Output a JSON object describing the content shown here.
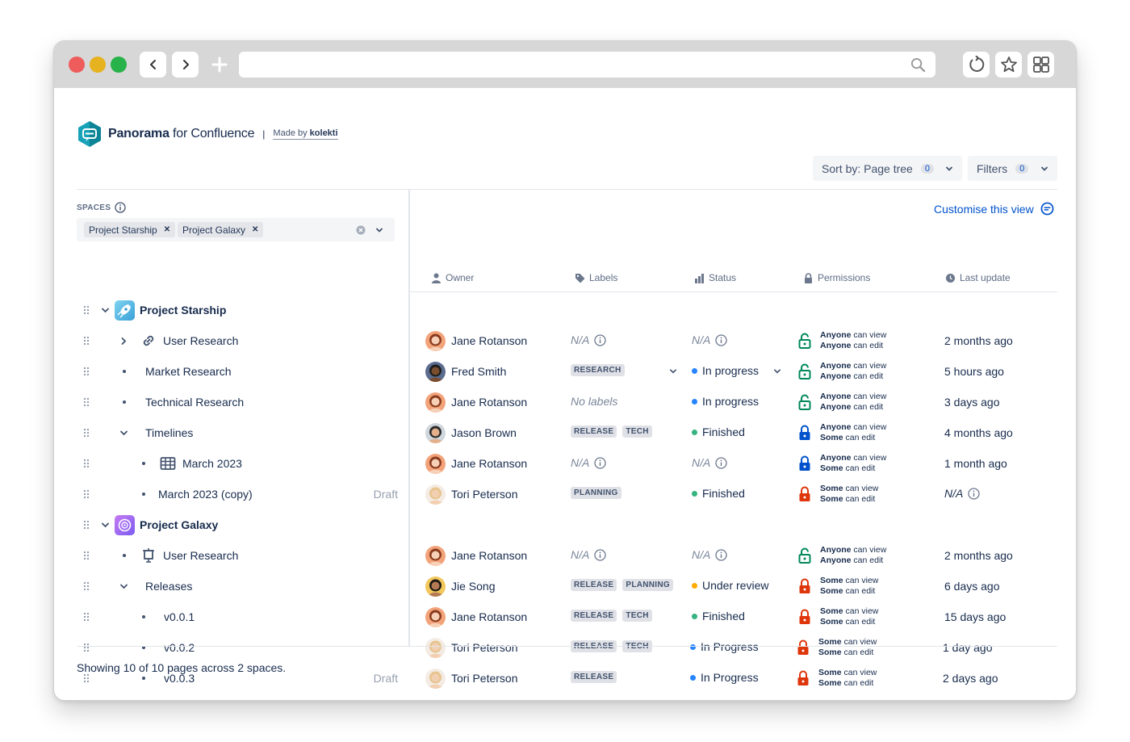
{
  "app": {
    "brand_bold": "Panorama",
    "brand_rest": " for Confluence",
    "separator": "|",
    "made_by_prefix": "Made by ",
    "made_by_company": "kolekti"
  },
  "toolbar": {
    "sort_label": "Sort by: Page tree",
    "sort_count": "0",
    "filters_label": "Filters",
    "filters_count": "0"
  },
  "spaces": {
    "heading": "SPACES",
    "selected": [
      "Project Starship",
      "Project Galaxy"
    ]
  },
  "customise_label": "Customise this view",
  "columns": {
    "owner": "Owner",
    "labels": "Labels",
    "status": "Status",
    "permissions": "Permissions",
    "last_update": "Last update"
  },
  "tree": [
    {
      "label": "Project Starship",
      "draft": ""
    },
    {
      "label": "User Research",
      "draft": ""
    },
    {
      "label": "Market Research",
      "draft": ""
    },
    {
      "label": "Technical Research",
      "draft": ""
    },
    {
      "label": "Timelines",
      "draft": ""
    },
    {
      "label": "March 2023",
      "draft": ""
    },
    {
      "label": "March 2023 (copy)",
      "draft": "Draft"
    },
    {
      "label": "Project Galaxy",
      "draft": ""
    },
    {
      "label": "User Research",
      "draft": ""
    },
    {
      "label": "Releases",
      "draft": ""
    },
    {
      "label": "v0.0.1",
      "draft": ""
    },
    {
      "label": "v0.0.2",
      "draft": ""
    },
    {
      "label": "v0.0.3",
      "draft": "Draft"
    }
  ],
  "na_text": "N/A",
  "rows": [
    {
      "owner": "Jane Rotanson",
      "labels_na": "N/A",
      "labels": [],
      "status_na": "N/A",
      "status": "",
      "status_color": "",
      "view_who": "Anyone",
      "view_txt": " can view",
      "edit_who": "Anyone",
      "edit_txt": " can  edit",
      "lock": "open",
      "updated": "2 months ago"
    },
    {
      "owner": "Fred Smith",
      "labels_na": "",
      "labels": [
        "RESEARCH"
      ],
      "status_na": "",
      "status": "In progress",
      "status_color": "#2684ff",
      "view_who": "Anyone",
      "view_txt": " can view",
      "edit_who": "Anyone",
      "edit_txt": " can edit",
      "lock": "open",
      "updated": "5 hours ago"
    },
    {
      "owner": "Jane Rotanson",
      "labels_na": "",
      "nolabels": "No labels",
      "labels": [],
      "status_na": "",
      "status": "In progress",
      "status_color": "#2684ff",
      "view_who": "Anyone",
      "view_txt": " can view",
      "edit_who": "Anyone",
      "edit_txt": " can edit",
      "lock": "open",
      "updated": "3 days ago"
    },
    {
      "owner": "Jason Brown",
      "labels_na": "",
      "labels": [
        "RELEASE",
        "TECH"
      ],
      "status_na": "",
      "status": "Finished",
      "status_color": "#36b37e",
      "view_who": "Anyone",
      "view_txt": " can view",
      "edit_who": "Some",
      "edit_txt": " can edit",
      "lock": "blue",
      "updated": "4 months ago"
    },
    {
      "owner": "Jane Rotanson",
      "labels_na": "N/A",
      "labels": [],
      "status_na": "N/A",
      "status": "",
      "status_color": "",
      "view_who": "Anyone",
      "view_txt": " can view",
      "edit_who": "Some",
      "edit_txt": " can edit",
      "lock": "blue",
      "updated": "1 month ago"
    },
    {
      "owner": "Tori Peterson",
      "labels_na": "",
      "labels": [
        "PLANNING"
      ],
      "status_na": "",
      "status": "Finished",
      "status_color": "#36b37e",
      "view_who": "Some",
      "view_txt": " can view",
      "edit_who": "Some",
      "edit_txt": " can edit",
      "lock": "red",
      "updated": "",
      "updated_na": "N/A"
    },
    {
      "owner": "Jane Rotanson",
      "labels_na": "N/A",
      "labels": [],
      "status_na": "N/A",
      "status": "",
      "status_color": "",
      "view_who": "Anyone",
      "view_txt": " can view",
      "edit_who": "Anyone",
      "edit_txt": " can edit",
      "lock": "open",
      "updated": "2 months ago"
    },
    {
      "owner": "Jie Song",
      "labels_na": "",
      "labels": [
        "RELEASE",
        "PLANNING"
      ],
      "status_na": "",
      "status": "Under review",
      "status_color": "#ffab00",
      "view_who": "Some",
      "view_txt": " can view",
      "edit_who": "Some",
      "edit_txt": " can edit",
      "lock": "red",
      "updated": "6 days ago"
    },
    {
      "owner": "Jane Rotanson",
      "labels_na": "",
      "labels": [
        "RELEASE",
        "TECH"
      ],
      "status_na": "",
      "status": "Finished",
      "status_color": "#36b37e",
      "view_who": "Some",
      "view_txt": " can view",
      "edit_who": "Some",
      "edit_txt": " can edit",
      "lock": "red",
      "updated": "15 days ago"
    },
    {
      "owner": "Tori Peterson",
      "labels_na": "",
      "labels": [
        "RELEASE",
        "TECH"
      ],
      "status_na": "",
      "status": "In Progress",
      "status_color": "#2684ff",
      "view_who": "Some",
      "view_txt": " can view",
      "edit_who": "Some",
      "edit_txt": " can edit",
      "lock": "red",
      "updated": "1 day ago"
    },
    {
      "owner": "Tori Peterson",
      "labels_na": "",
      "labels": [
        "RELEASE"
      ],
      "status_na": "",
      "status": "In Progress",
      "status_color": "#2684ff",
      "view_who": "Some",
      "view_txt": " can view",
      "edit_who": "Some",
      "edit_txt": " can edit",
      "lock": "red",
      "updated": "2 days ago"
    }
  ],
  "footer": "Showing 10 of 10 pages across 2 spaces.",
  "colors": {
    "link": "#0052cc",
    "lock_open": "#00875a",
    "lock_some_edit": "#0052cc",
    "lock_restricted": "#de350b"
  }
}
